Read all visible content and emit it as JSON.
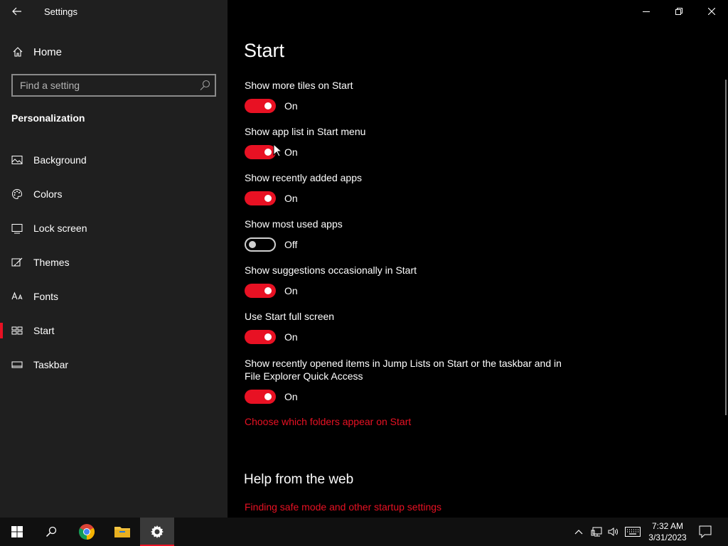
{
  "window": {
    "title": "Settings",
    "controls": [
      "minimize-icon",
      "restore-icon",
      "close-icon"
    ]
  },
  "sidebar": {
    "home_label": "Home",
    "search_placeholder": "Find a setting",
    "section_title": "Personalization",
    "items": [
      {
        "label": "Background",
        "icon": "picture-icon"
      },
      {
        "label": "Colors",
        "icon": "palette-icon"
      },
      {
        "label": "Lock screen",
        "icon": "lock-screen-icon"
      },
      {
        "label": "Themes",
        "icon": "brush-icon"
      },
      {
        "label": "Fonts",
        "icon": "font-icon"
      },
      {
        "label": "Start",
        "icon": "start-tiles-icon",
        "active": true
      },
      {
        "label": "Taskbar",
        "icon": "taskbar-icon"
      }
    ]
  },
  "main": {
    "title": "Start",
    "settings": [
      {
        "label": "Show more tiles on Start",
        "state": "On"
      },
      {
        "label": "Show app list in Start menu",
        "state": "On"
      },
      {
        "label": "Show recently added apps",
        "state": "On"
      },
      {
        "label": "Show most used apps",
        "state": "Off"
      },
      {
        "label": "Show suggestions occasionally in Start",
        "state": "On"
      },
      {
        "label": "Use Start full screen",
        "state": "On"
      },
      {
        "label": "Show recently opened items in Jump Lists on Start or the taskbar and in File Explorer Quick Access",
        "state": "On"
      }
    ],
    "folders_link": "Choose which folders appear on Start",
    "help_title": "Help from the web",
    "help_link": "Finding safe mode and other startup settings"
  },
  "taskbar": {
    "time": "7:32 AM",
    "date": "3/31/2023"
  },
  "colors": {
    "accent": "#e81123",
    "sidebar_bg": "#1f1f1f",
    "content_bg": "#000000",
    "taskbar_bg": "#101010"
  }
}
